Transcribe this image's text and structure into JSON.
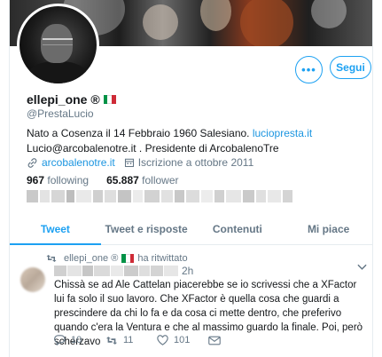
{
  "profile": {
    "name": "ellepi_one ®",
    "handle": "@PrestaLucio",
    "bio_prefix": "Nato a Cosenza il 14 Febbraio 1960 Salesiano.",
    "bio_link": "luciopresta.it",
    "bio_suffix": "Lucio@arcobalenotre.it . Presidente di ArcobalenoTre",
    "website": "arcobalenotre.it",
    "joined": "Iscrizione a ottobre 2011",
    "following_count": "967",
    "following_label": "following",
    "follower_count": "65.887",
    "follower_label": "follower"
  },
  "buttons": {
    "more_label": "•••",
    "follow_label": "Segui"
  },
  "tabs": [
    {
      "label": "Tweet",
      "active": true
    },
    {
      "label": "Tweet e risposte",
      "active": false
    },
    {
      "label": "Contenuti",
      "active": false
    },
    {
      "label": "Mi piace",
      "active": false
    }
  ],
  "tweet": {
    "retweeter": "ellepi_one ®",
    "retweet_suffix": "ha ritwittato",
    "time": "2h",
    "text": "Chissà se ad Ale Cattelan piacerebbe se io scrivessi che a XFactor lui fa solo il suo lavoro. Che XFactor è quella cosa che guardi a prescindere da chi lo fa e da cosa ci mette dentro, che preferivo quando c'era la Ventura e che al massimo guardo la finale. Poi, però scherzavo",
    "replies": "10",
    "retweets": "11",
    "likes": "101"
  },
  "colors": {
    "accent": "#1da1f2",
    "link": "#1b95e0",
    "muted": "#657786",
    "retweet_green": "#17bf63"
  },
  "icons": [
    "more-icon",
    "link-icon",
    "calendar-icon",
    "retweet-icon",
    "reply-icon",
    "like-icon",
    "message-icon",
    "caret-down-icon",
    "italian-flag-icon"
  ]
}
